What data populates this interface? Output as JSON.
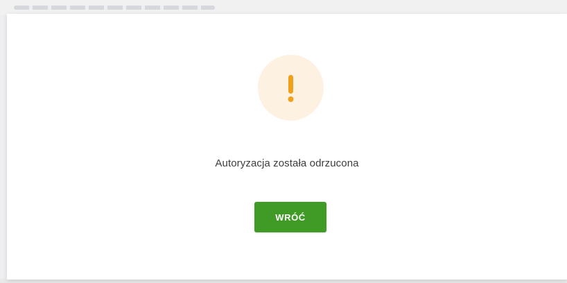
{
  "dialog": {
    "icon": "exclamation-warning-icon",
    "icon_color": "#f0a11b",
    "icon_bg_color": "#fdf1e2",
    "message": "Autoryzacja została odrzucona",
    "back_button_label": "WRÓĆ",
    "back_button_color": "#3f9b26"
  }
}
